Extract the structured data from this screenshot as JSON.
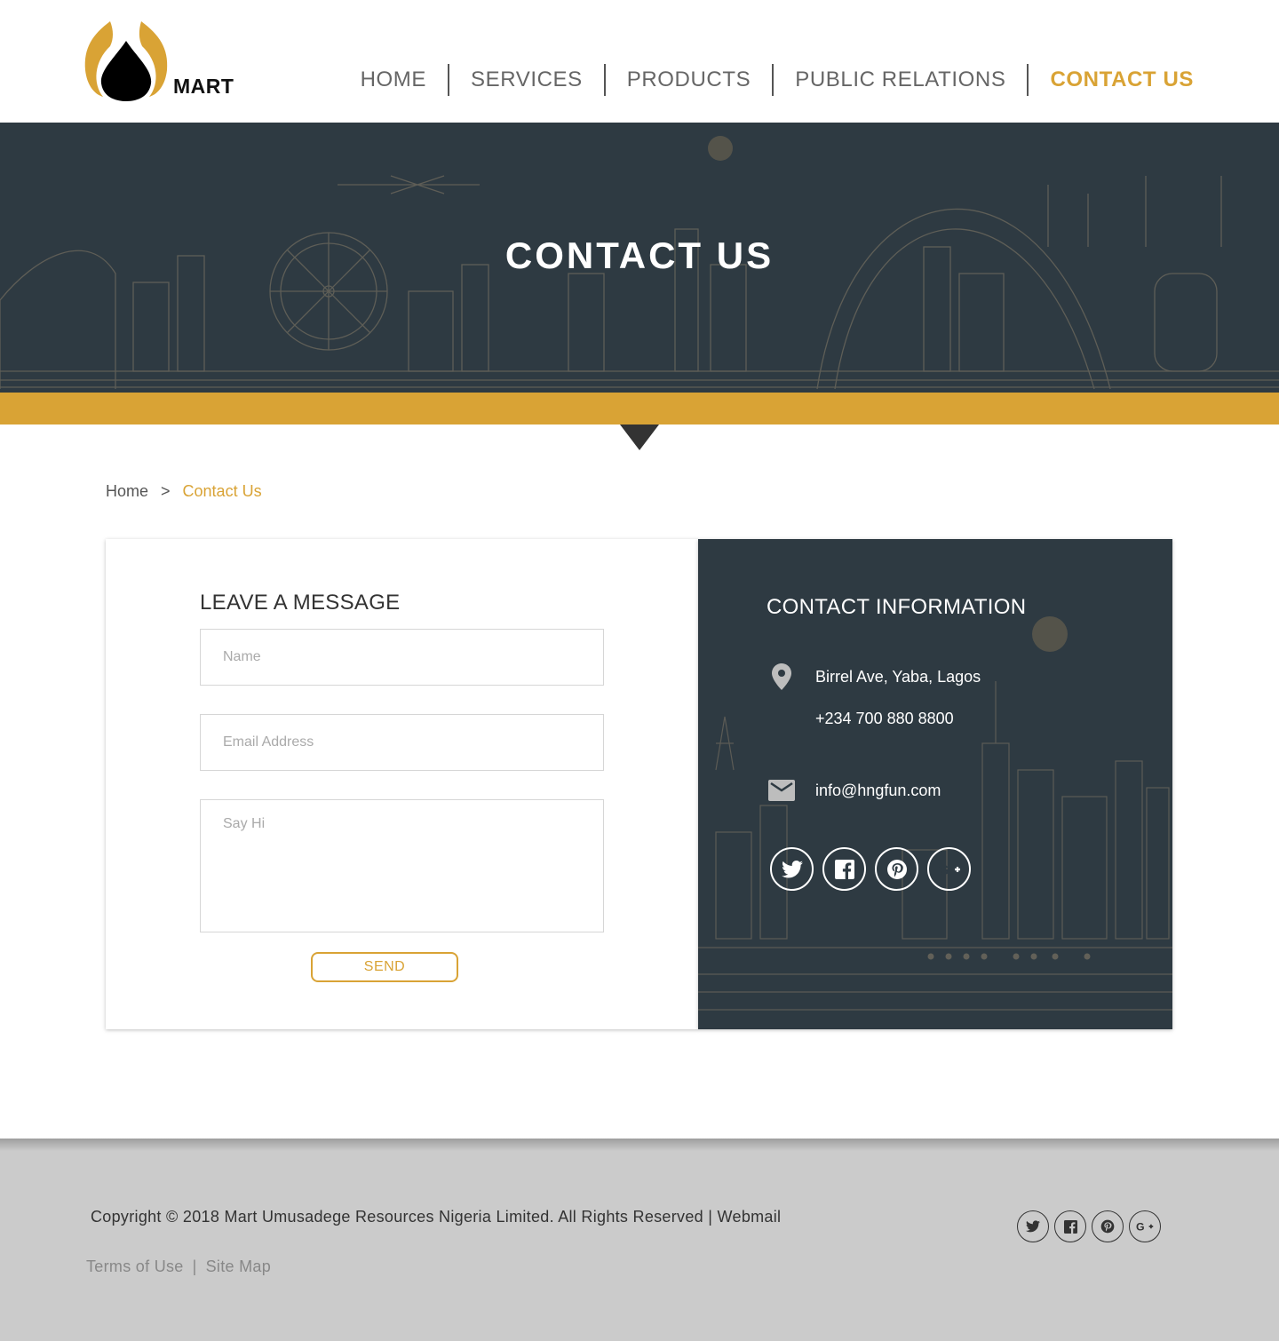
{
  "header": {
    "logo_text": "MART",
    "nav": [
      {
        "label": "HOME"
      },
      {
        "label": "SERVICES"
      },
      {
        "label": "PRODUCTS"
      },
      {
        "label": "PUBLIC RELATIONS"
      },
      {
        "label": "CONTACT US",
        "active": true
      }
    ]
  },
  "banner": {
    "title": "CONTACT US"
  },
  "breadcrumb": {
    "home": "Home",
    "separator": ">",
    "current": "Contact Us"
  },
  "form": {
    "title": "LEAVE A MESSAGE",
    "name_placeholder": "Name",
    "email_placeholder": "Email Address",
    "message_placeholder": "Say Hi",
    "send_label": "SEND"
  },
  "contact_info": {
    "title": "CONTACT INFORMATION",
    "address": "Birrel Ave, Yaba, Lagos",
    "phone": "+234 700 880 8800",
    "email": "info@hngfun.com",
    "socials": [
      "twitter-icon",
      "facebook-icon",
      "pinterest-icon",
      "google-plus-icon"
    ]
  },
  "footer": {
    "copyright": "Copyright © 2018 Mart Umusadege Resources Nigeria Limited. All Rights Reserved | Webmail",
    "terms": "Terms of Use",
    "links_separator": "|",
    "sitemap": "Site Map",
    "socials": [
      "twitter-icon",
      "facebook-icon",
      "pinterest-icon",
      "google-plus-icon"
    ]
  },
  "colors": {
    "accent": "#d9a335",
    "dark": "#2e3a42",
    "footer_bg": "#cbcbcb"
  }
}
